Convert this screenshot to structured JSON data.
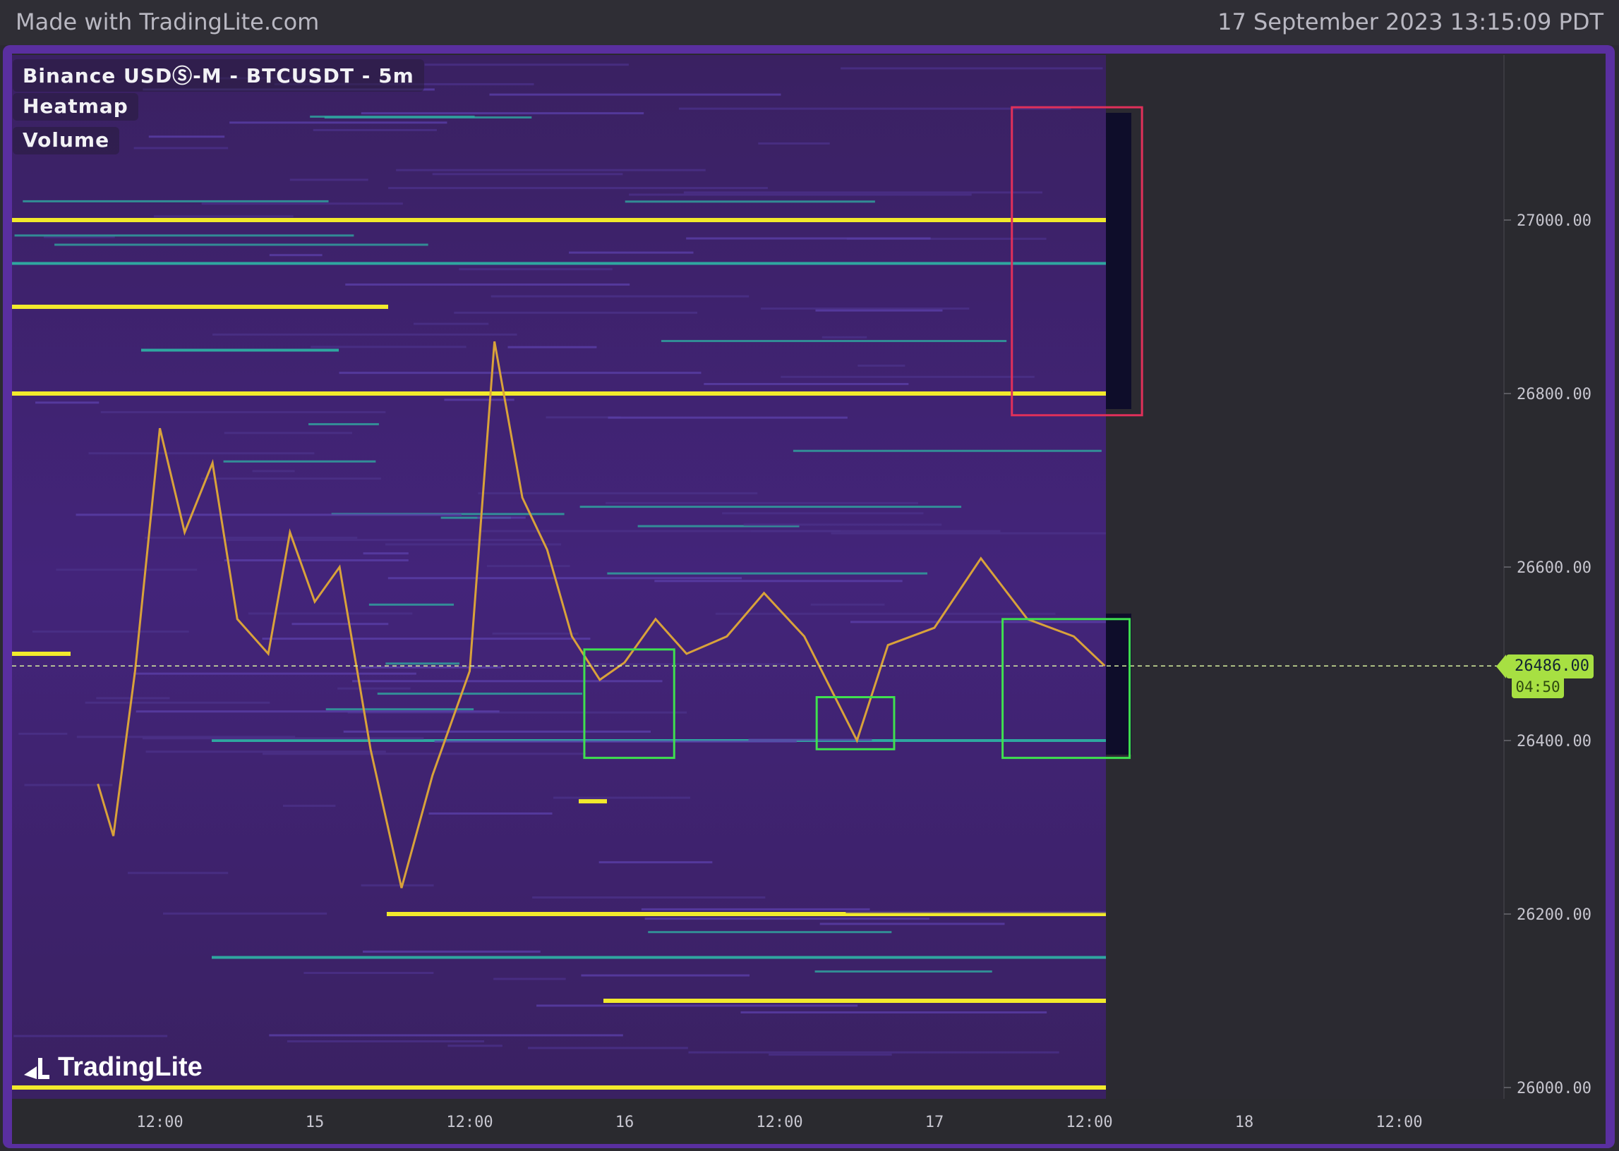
{
  "header": {
    "brand": "Made with TradingLite.com",
    "timestamp": "17 September 2023 13:15:09 PDT"
  },
  "legend": {
    "market": "Binance USDⓈ-M - BTCUSDT - 5m",
    "layer1": "Heatmap",
    "layer2": "Volume"
  },
  "logo": {
    "text": "TradingLite",
    "icon": "tradinglite-logo-icon"
  },
  "colors": {
    "frame": "#5a2fa0",
    "heatmap_bg": "#3b2463",
    "liquidity_high": "#f2ea2c",
    "liquidity_mid": "#2fa7a0",
    "liquidity_low": "#4c3a9a",
    "price_tag": "#a7e042",
    "resistance_box": "#e0305a",
    "support_box": "#3fe04f"
  },
  "price_tag": {
    "price": "26486.00",
    "countdown": "04:50"
  },
  "chart_data": {
    "type": "heatmap",
    "title": "",
    "y_axis": {
      "ticks": [
        "27000.00",
        "26800.00",
        "26600.00",
        "26400.00",
        "26200.00",
        "26000.00"
      ],
      "range": [
        25995,
        27200
      ]
    },
    "x_axis": {
      "ticks": [
        "12:00",
        "15",
        "12:00",
        "16",
        "12:00",
        "17",
        "12:00",
        "18",
        "12:00"
      ]
    },
    "current_price": 26486,
    "liquidity_levels": [
      {
        "price": 27000,
        "intensity": "high"
      },
      {
        "price": 26900,
        "intensity": "high"
      },
      {
        "price": 26800,
        "intensity": "high"
      },
      {
        "price": 26500,
        "intensity": "high"
      },
      {
        "price": 26330,
        "intensity": "high"
      },
      {
        "price": 26200,
        "intensity": "high"
      },
      {
        "price": 26100,
        "intensity": "high"
      },
      {
        "price": 26000,
        "intensity": "high"
      },
      {
        "price": 26950,
        "intensity": "mid"
      },
      {
        "price": 26850,
        "intensity": "mid"
      },
      {
        "price": 26400,
        "intensity": "mid"
      },
      {
        "price": 26150,
        "intensity": "mid"
      }
    ],
    "price_path": [
      {
        "day": 14.3,
        "price": 26350
      },
      {
        "day": 14.35,
        "price": 26290
      },
      {
        "day": 14.42,
        "price": 26480
      },
      {
        "day": 14.5,
        "price": 26760
      },
      {
        "day": 14.58,
        "price": 26640
      },
      {
        "day": 14.67,
        "price": 26720
      },
      {
        "day": 14.75,
        "price": 26540
      },
      {
        "day": 14.85,
        "price": 26500
      },
      {
        "day": 14.92,
        "price": 26640
      },
      {
        "day": 15.0,
        "price": 26560
      },
      {
        "day": 15.08,
        "price": 26600
      },
      {
        "day": 15.18,
        "price": 26390
      },
      {
        "day": 15.28,
        "price": 26230
      },
      {
        "day": 15.38,
        "price": 26360
      },
      {
        "day": 15.5,
        "price": 26480
      },
      {
        "day": 15.58,
        "price": 26860
      },
      {
        "day": 15.67,
        "price": 26680
      },
      {
        "day": 15.75,
        "price": 26620
      },
      {
        "day": 15.83,
        "price": 26520
      },
      {
        "day": 15.92,
        "price": 26470
      },
      {
        "day": 16.0,
        "price": 26490
      },
      {
        "day": 16.1,
        "price": 26540
      },
      {
        "day": 16.2,
        "price": 26500
      },
      {
        "day": 16.33,
        "price": 26520
      },
      {
        "day": 16.45,
        "price": 26570
      },
      {
        "day": 16.58,
        "price": 26520
      },
      {
        "day": 16.75,
        "price": 26400
      },
      {
        "day": 16.85,
        "price": 26510
      },
      {
        "day": 17.0,
        "price": 26530
      },
      {
        "day": 17.15,
        "price": 26610
      },
      {
        "day": 17.3,
        "price": 26540
      },
      {
        "day": 17.45,
        "price": 26520
      },
      {
        "day": 17.55,
        "price": 26486
      }
    ],
    "annotations": [
      {
        "type": "box",
        "color": "resistance",
        "day_range": [
          17.25,
          17.67
        ],
        "price_range": [
          26775,
          27130
        ]
      },
      {
        "type": "box",
        "color": "support",
        "day_range": [
          15.87,
          16.16
        ],
        "price_range": [
          26380,
          26505
        ]
      },
      {
        "type": "box",
        "color": "support",
        "day_range": [
          16.62,
          16.87
        ],
        "price_range": [
          26390,
          26450
        ]
      },
      {
        "type": "box",
        "color": "support",
        "day_range": [
          17.22,
          17.63
        ],
        "price_range": [
          26380,
          26540
        ]
      }
    ]
  }
}
